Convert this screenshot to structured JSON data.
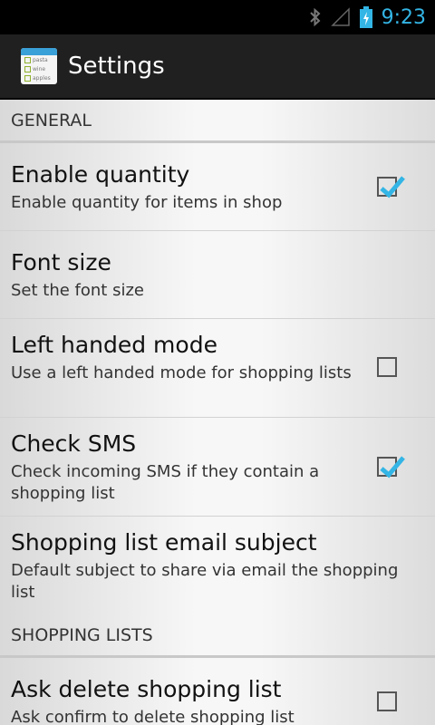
{
  "status_bar": {
    "time": "9:23",
    "icons": [
      "bluetooth-icon",
      "signal-icon",
      "battery-charging-icon"
    ],
    "clock_color": "#33b5e5"
  },
  "action_bar": {
    "app_icon_lines": [
      "pasta",
      "wine",
      "apples"
    ],
    "title": "Settings"
  },
  "sections": [
    {
      "header": "GENERAL",
      "items": [
        {
          "title": "Enable quantity",
          "summary": "Enable quantity for items in shop",
          "checkbox": true,
          "checked": true
        },
        {
          "title": "Font size",
          "summary": "Set the font size",
          "checkbox": false
        },
        {
          "title": "Left handed mode",
          "summary": "Use a left handed mode for shopping lists",
          "checkbox": true,
          "checked": false
        },
        {
          "title": "Check SMS",
          "summary": "Check incoming SMS if they contain a shopping list",
          "checkbox": true,
          "checked": true
        },
        {
          "title": "Shopping list email subject",
          "summary": "Default subject to share via email the shopping list",
          "checkbox": false
        }
      ]
    },
    {
      "header": "SHOPPING LISTS",
      "items": [
        {
          "title": "Ask delete shopping list",
          "summary": "Ask confirm to delete shopping list",
          "checkbox": true,
          "checked": false
        }
      ]
    }
  ],
  "colors": {
    "accent": "#33b5e5",
    "action_bar": "#202020"
  }
}
